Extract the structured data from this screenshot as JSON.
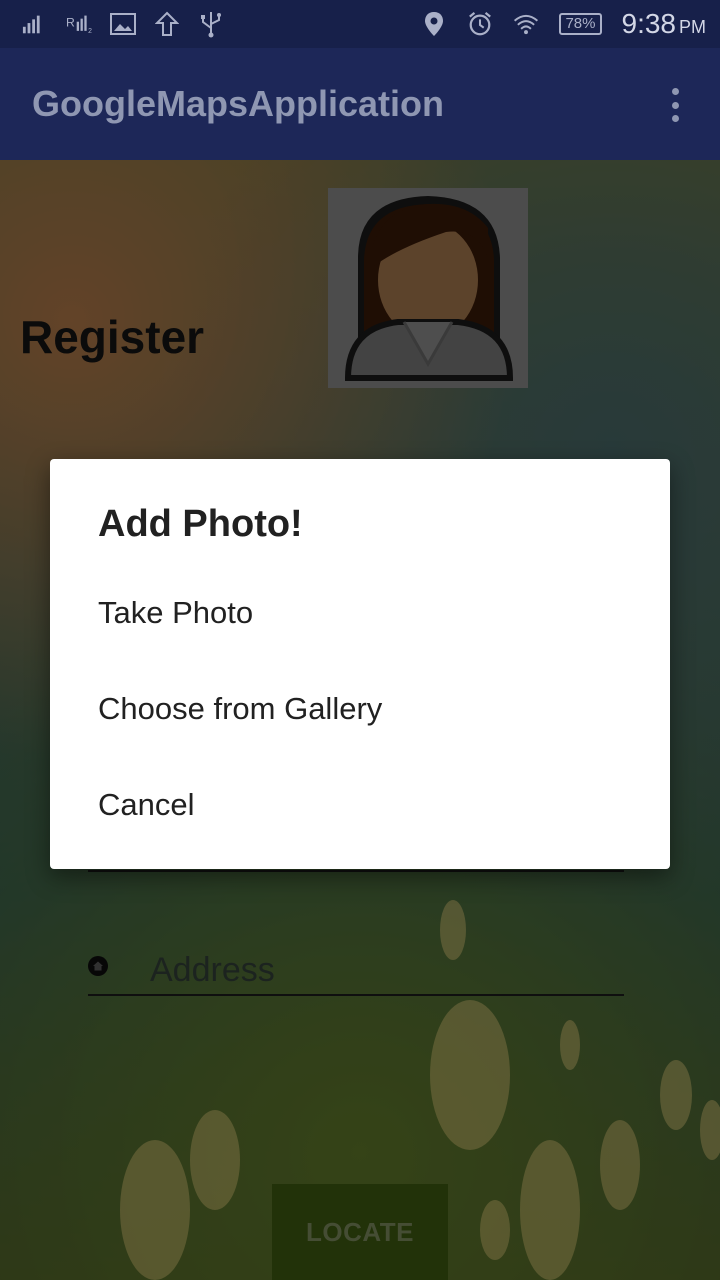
{
  "status_bar": {
    "signal_1_label": "1",
    "signal_2_label": "R",
    "signal_2_sub": "2",
    "battery": "78%",
    "time": "9:38",
    "ampm": "PM",
    "icons": [
      "signal-icon",
      "signal-roaming-icon",
      "image-icon",
      "upload-icon",
      "usb-icon",
      "location-icon",
      "alarm-icon",
      "wifi-icon",
      "battery-icon"
    ]
  },
  "toolbar": {
    "title": "GoogleMapsApplication",
    "overflow_icon": "more-vert-icon"
  },
  "form": {
    "heading": "Register",
    "address_placeholder": "Address",
    "locate_button": "LOCATE"
  },
  "dialog": {
    "title": "Add Photo!",
    "options": [
      "Take Photo",
      "Choose from Gallery",
      "Cancel"
    ]
  },
  "colors": {
    "toolbar": "#1d2758",
    "status_bar": "#17204a",
    "dialog_bg": "#ffffff",
    "locate_button": "#3f5b12"
  }
}
